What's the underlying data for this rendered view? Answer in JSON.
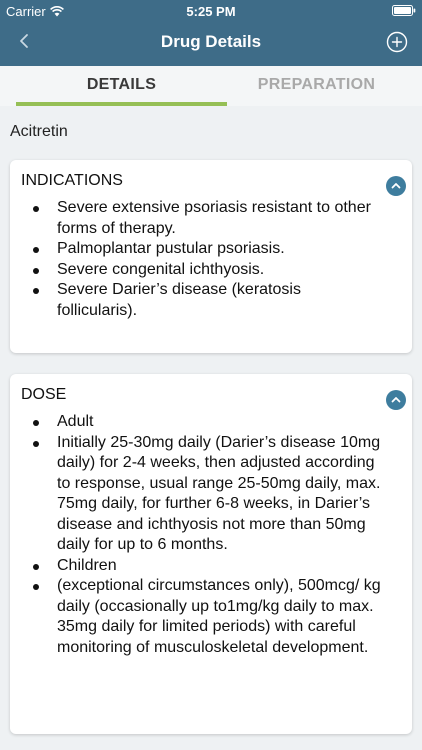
{
  "status_bar": {
    "carrier": "Carrier",
    "time": "5:25 PM"
  },
  "nav": {
    "title": "Drug Details",
    "back_icon": "chevron-left-icon",
    "add_icon": "plus-circle-icon"
  },
  "tabs": [
    {
      "label": "DETAILS",
      "active": true
    },
    {
      "label": "PREPARATION",
      "active": false
    }
  ],
  "drug_name": "Acitretin",
  "sections": [
    {
      "title": "INDICATIONS",
      "expanded": true,
      "items": [
        "Severe extensive psoriasis resistant to other forms of therapy.",
        "Palmoplantar pustular psoriasis.",
        "Severe congenital ichthyosis.",
        "Severe Darier’s disease (keratosis follicularis)."
      ]
    },
    {
      "title": "DOSE",
      "expanded": true,
      "items": [
        "Adult",
        "Initially 25-30mg daily (Darier’s disease 10mg daily) for 2-4 weeks, then adjusted according to response, usual range 25-50mg daily, max. 75mg daily, for further 6-8 weeks, in Darier’s disease and ichthyosis not more than 50mg daily for up to 6 months.",
        "Children",
        "(exceptional circumstances only), 500mcg/ kg daily (occasionally up to1mg/kg daily to max. 35mg daily for limited periods) with careful monitoring of musculoskeletal development."
      ]
    }
  ],
  "colors": {
    "header": "#3e6c88",
    "tab_indicator": "#95bf55",
    "toggle": "#3e7d9e",
    "background": "#eef1f3"
  }
}
